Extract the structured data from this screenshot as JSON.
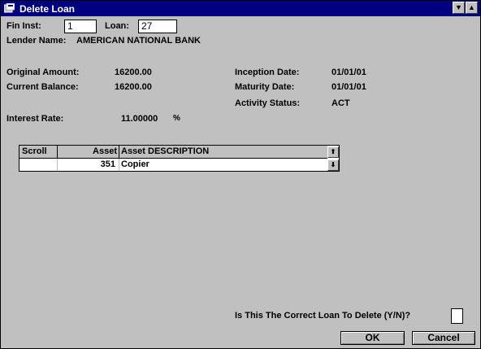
{
  "window": {
    "title": "Delete Loan"
  },
  "header": {
    "fin_inst_label": "Fin Inst:",
    "fin_inst_value": "1",
    "loan_label": "Loan:",
    "loan_value": "27",
    "lender_label": "Lender Name:",
    "lender_value": "AMERICAN NATIONAL BANK"
  },
  "details": {
    "original_amount_label": "Original Amount:",
    "original_amount_value": "16200.00",
    "current_balance_label": "Current Balance:",
    "current_balance_value": "16200.00",
    "inception_date_label": "Inception Date:",
    "inception_date_value": "01/01/01",
    "maturity_date_label": "Maturity Date:",
    "maturity_date_value": "01/01/01",
    "activity_status_label": "Activity Status:",
    "activity_status_value": "ACT",
    "interest_rate_label": "Interest Rate:",
    "interest_rate_value": "11.00000",
    "interest_rate_unit": "%"
  },
  "grid": {
    "columns": [
      "Scroll",
      "Asset",
      "Asset DESCRIPTION"
    ],
    "rows": [
      {
        "scroll": "",
        "asset": "351",
        "description": "Copier"
      }
    ]
  },
  "confirm": {
    "question": "Is This The Correct Loan To Delete (Y/N)?",
    "answer": ""
  },
  "buttons": {
    "ok": "OK",
    "cancel": "Cancel"
  }
}
